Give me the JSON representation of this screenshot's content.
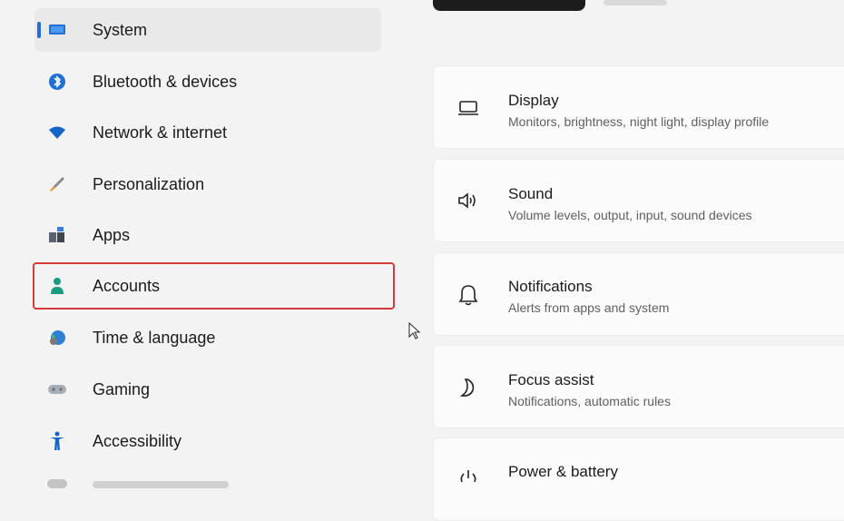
{
  "sidebar": {
    "items": [
      {
        "label": "System",
        "icon": "monitor-icon",
        "selected": true
      },
      {
        "label": "Bluetooth & devices",
        "icon": "bluetooth-icon"
      },
      {
        "label": "Network & internet",
        "icon": "wifi-icon"
      },
      {
        "label": "Personalization",
        "icon": "brush-icon"
      },
      {
        "label": "Apps",
        "icon": "apps-icon"
      },
      {
        "label": "Accounts",
        "icon": "person-icon",
        "highlighted": true
      },
      {
        "label": "Time & language",
        "icon": "globe-clock-icon"
      },
      {
        "label": "Gaming",
        "icon": "gamepad-icon"
      },
      {
        "label": "Accessibility",
        "icon": "accessibility-icon"
      }
    ]
  },
  "main": {
    "cards": [
      {
        "title": "Display",
        "subtitle": "Monitors, brightness, night light, display profile",
        "icon": "display-icon"
      },
      {
        "title": "Sound",
        "subtitle": "Volume levels, output, input, sound devices",
        "icon": "speaker-icon"
      },
      {
        "title": "Notifications",
        "subtitle": "Alerts from apps and system",
        "icon": "bell-icon"
      },
      {
        "title": "Focus assist",
        "subtitle": "Notifications, automatic rules",
        "icon": "moon-icon"
      },
      {
        "title": "Power & battery",
        "subtitle": "",
        "icon": "power-icon"
      }
    ]
  },
  "colors": {
    "accent": "#1f6fd6",
    "highlight_border": "#d63a3a",
    "background": "#f3f3f3",
    "card": "#fbfbfb"
  }
}
